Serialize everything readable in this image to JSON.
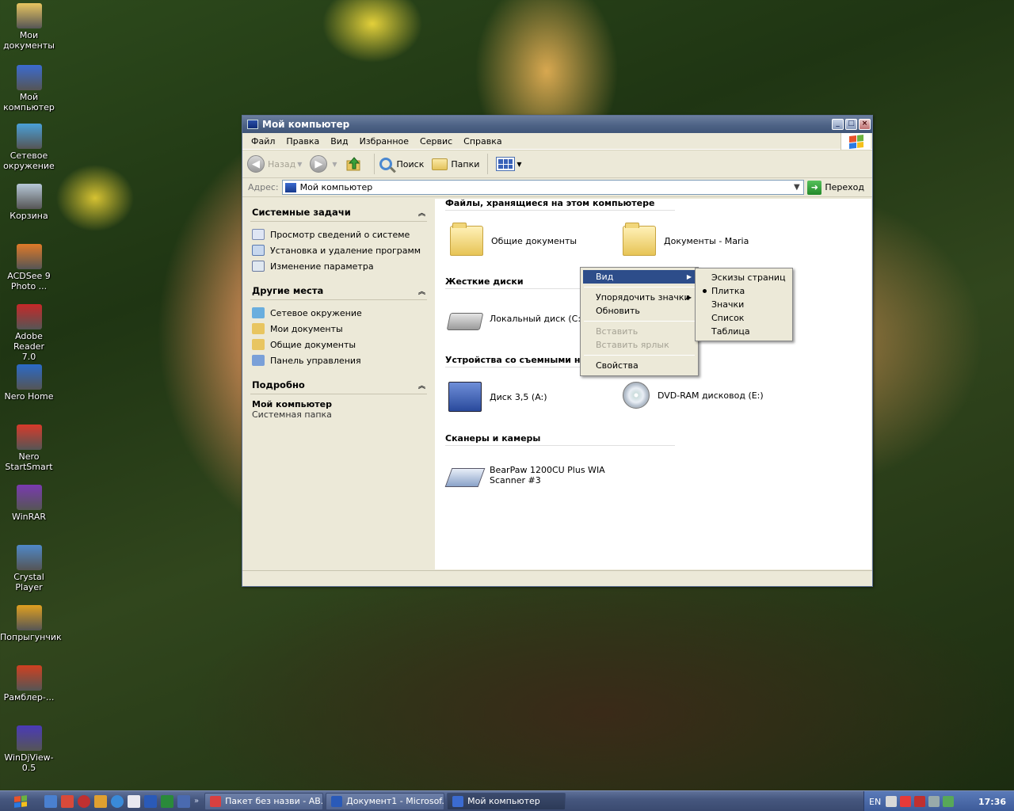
{
  "desktop": {
    "icons": [
      {
        "label": "Мои\nдокументы",
        "icon": "my-documents-folder-icon",
        "color": "#e8c560"
      },
      {
        "label": "Мой\nкомпьютер",
        "icon": "my-computer-icon",
        "color": "#3b6bd0"
      },
      {
        "label": "Сетевое\nокружение",
        "icon": "network-places-icon",
        "color": "#4aa0d8"
      },
      {
        "label": "Корзина",
        "icon": "recycle-bin-icon",
        "color": "#b7c8d8"
      },
      {
        "label": "ACDSee 9\nPhoto ...",
        "icon": "acdsee-icon",
        "color": "#e07a28"
      },
      {
        "label": "Adobe Reader\n7.0",
        "icon": "adobe-reader-icon",
        "color": "#c62828"
      },
      {
        "label": "Nero Home",
        "icon": "nero-home-icon",
        "color": "#2a6ac8"
      },
      {
        "label": "Nero\nStartSmart",
        "icon": "nero-startsmart-icon",
        "color": "#d83a2a"
      },
      {
        "label": "WinRAR",
        "icon": "winrar-icon",
        "color": "#7a3ab0"
      },
      {
        "label": "Crystal Player",
        "icon": "crystal-player-icon",
        "color": "#4f88c8"
      },
      {
        "label": "Попрыгунчик",
        "icon": "popryguchik-icon",
        "color": "#e0a020"
      },
      {
        "label": "Рамблер-...",
        "icon": "rambler-icon",
        "color": "#d04020"
      },
      {
        "label": "WinDjView-0.5",
        "icon": "windjview-icon",
        "color": "#4a3ab8"
      }
    ]
  },
  "window": {
    "title": "Мой компьютер",
    "menu": [
      "Файл",
      "Правка",
      "Вид",
      "Избранное",
      "Сервис",
      "Справка"
    ],
    "toolbar": {
      "back": "Назад",
      "search": "Поиск",
      "folders": "Папки"
    },
    "address": {
      "label": "Адрес:",
      "value": "Мой компьютер",
      "go": "Переход"
    },
    "tasks": {
      "system": {
        "title": "Системные задачи",
        "items": [
          "Просмотр сведений о системе",
          "Установка и удаление программ",
          "Изменение параметра"
        ]
      },
      "places": {
        "title": "Другие места",
        "items": [
          "Сетевое окружение",
          "Мои документы",
          "Общие документы",
          "Панель управления"
        ]
      },
      "details": {
        "title": "Подробно",
        "name": "Мой компьютер",
        "type": "Системная папка"
      }
    },
    "content": {
      "sections": [
        "Файлы, хранящиеся на этом компьютере",
        "Жесткие диски",
        "Устройства со съемными нос",
        "Сканеры и камеры"
      ],
      "items": {
        "shared_docs": "Общие документы",
        "maria_docs": "Документы - Maria",
        "local_disk": "Локальный диск (C:)",
        "floppy": "Диск 3,5 (A:)",
        "dvd": "DVD-RAM дисковод (E:)",
        "scanner": "BearPaw 1200CU Plus WIA\nScanner #3"
      }
    }
  },
  "context_menu": {
    "view": "Вид",
    "arrange": "Упорядочить значки",
    "refresh": "Обновить",
    "paste": "Вставить",
    "paste_shortcut": "Вставить ярлык",
    "properties": "Свойства"
  },
  "view_submenu": {
    "items": [
      "Эскизы страниц",
      "Плитка",
      "Значки",
      "Список",
      "Таблица"
    ],
    "selected": "Плитка"
  },
  "taskbar": {
    "tasks": [
      {
        "label": "Пакет без назви - AB...",
        "active": false
      },
      {
        "label": "Документ1 - Microsof...",
        "active": false
      },
      {
        "label": "Мой компьютер",
        "active": true
      }
    ],
    "lang": "EN",
    "clock": "17:36"
  }
}
